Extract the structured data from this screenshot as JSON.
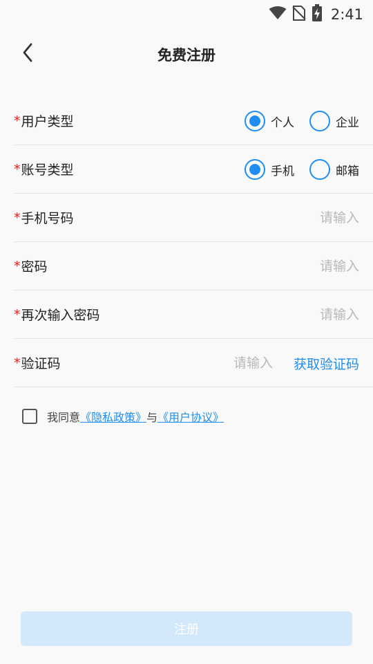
{
  "status_bar": {
    "time": "2:41",
    "icons": [
      "wifi-icon",
      "no-sim-icon",
      "battery-charging-icon"
    ]
  },
  "header": {
    "title": "免费注册",
    "back_icon": "chevron-left-icon"
  },
  "form": {
    "required_mark": "*",
    "user_type": {
      "label": "用户类型",
      "options": [
        {
          "label": "个人",
          "selected": true
        },
        {
          "label": "企业",
          "selected": false
        }
      ]
    },
    "account_type": {
      "label": "账号类型",
      "options": [
        {
          "label": "手机",
          "selected": true
        },
        {
          "label": "邮箱",
          "selected": false
        }
      ]
    },
    "phone": {
      "label": "手机号码",
      "placeholder": "请输入",
      "value": ""
    },
    "password": {
      "label": "密码",
      "placeholder": "请输入",
      "value": ""
    },
    "password_confirm": {
      "label": "再次输入密码",
      "placeholder": "请输入",
      "value": ""
    },
    "verification": {
      "label": "验证码",
      "placeholder": "请输入",
      "value": "",
      "get_code_label": "获取验证码"
    }
  },
  "agreement": {
    "checked": false,
    "prefix": "我同意",
    "privacy_link": "《隐私政策》",
    "conjunction": "与",
    "terms_link": "《用户协议》"
  },
  "register_button": {
    "label": "注册"
  },
  "colors": {
    "accent": "#1f8ef0",
    "required": "#e02020",
    "button_disabled_bg": "#d3e8fb",
    "placeholder": "#b8b8b8"
  }
}
